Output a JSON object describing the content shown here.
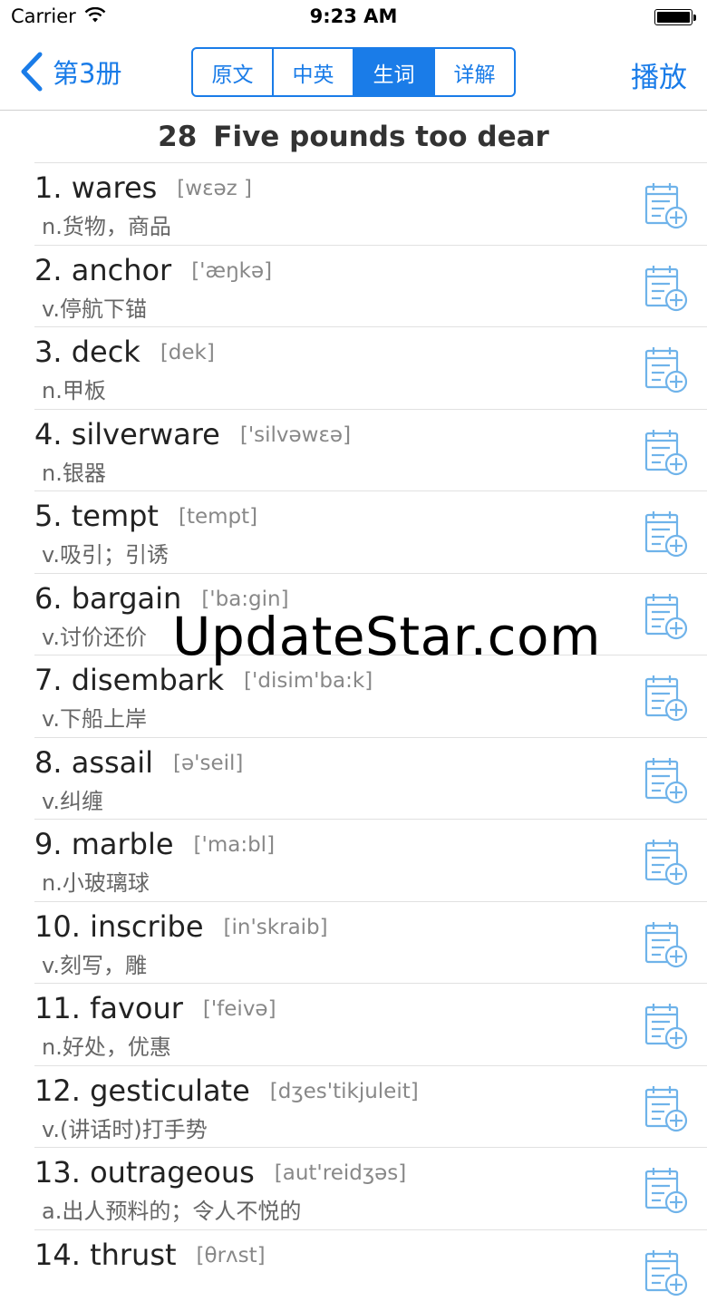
{
  "status": {
    "carrier": "Carrier",
    "time": "9:23 AM"
  },
  "nav": {
    "back_label": "第3册",
    "segments": [
      "原文",
      "中英",
      "生词",
      "详解"
    ],
    "active_segment": "生词",
    "play_label": "播放"
  },
  "lesson": {
    "number": "28",
    "title": "Five pounds too dear"
  },
  "words": [
    {
      "index": "1.",
      "word": "wares",
      "phonetic": "[wɛəz ]",
      "definition": "n.货物，商品"
    },
    {
      "index": "2.",
      "word": "anchor",
      "phonetic": "['æŋkə]",
      "definition": "v.停航下锚"
    },
    {
      "index": "3.",
      "word": "deck",
      "phonetic": "[dek]",
      "definition": "n.甲板"
    },
    {
      "index": "4.",
      "word": "silverware",
      "phonetic": "['silvəwɛə]",
      "definition": "n.银器"
    },
    {
      "index": "5.",
      "word": "tempt",
      "phonetic": "[tempt]",
      "definition": "v.吸引；引诱"
    },
    {
      "index": "6.",
      "word": "bargain",
      "phonetic": "['ba:gin]",
      "definition": "v.讨价还价"
    },
    {
      "index": "7.",
      "word": "disembark",
      "phonetic": "['disim'ba:k]",
      "definition": "v.下船上岸"
    },
    {
      "index": "8.",
      "word": "assail",
      "phonetic": "[ə'seil]",
      "definition": "v.纠缠"
    },
    {
      "index": "9.",
      "word": "marble",
      "phonetic": "['ma:bl]",
      "definition": "n.小玻璃球"
    },
    {
      "index": "10.",
      "word": "inscribe",
      "phonetic": "[in'skraib]",
      "definition": "v.刻写，雕"
    },
    {
      "index": "11.",
      "word": "favour",
      "phonetic": "['feivə]",
      "definition": "n.好处，优惠"
    },
    {
      "index": "12.",
      "word": "gesticulate",
      "phonetic": "[dʒes'tikjuleit]",
      "definition": "v.(讲话时)打手势"
    },
    {
      "index": "13.",
      "word": "outrageous",
      "phonetic": "[aut'reidʒəs]",
      "definition": "a.出人预料的；令人不悦的"
    },
    {
      "index": "14.",
      "word": "thrust",
      "phonetic": "[θrʌst]",
      "definition": ""
    }
  ],
  "watermark": "UpdateStar.com",
  "colors": {
    "accent": "#1a7ce8",
    "icon": "#6fb3ea"
  }
}
